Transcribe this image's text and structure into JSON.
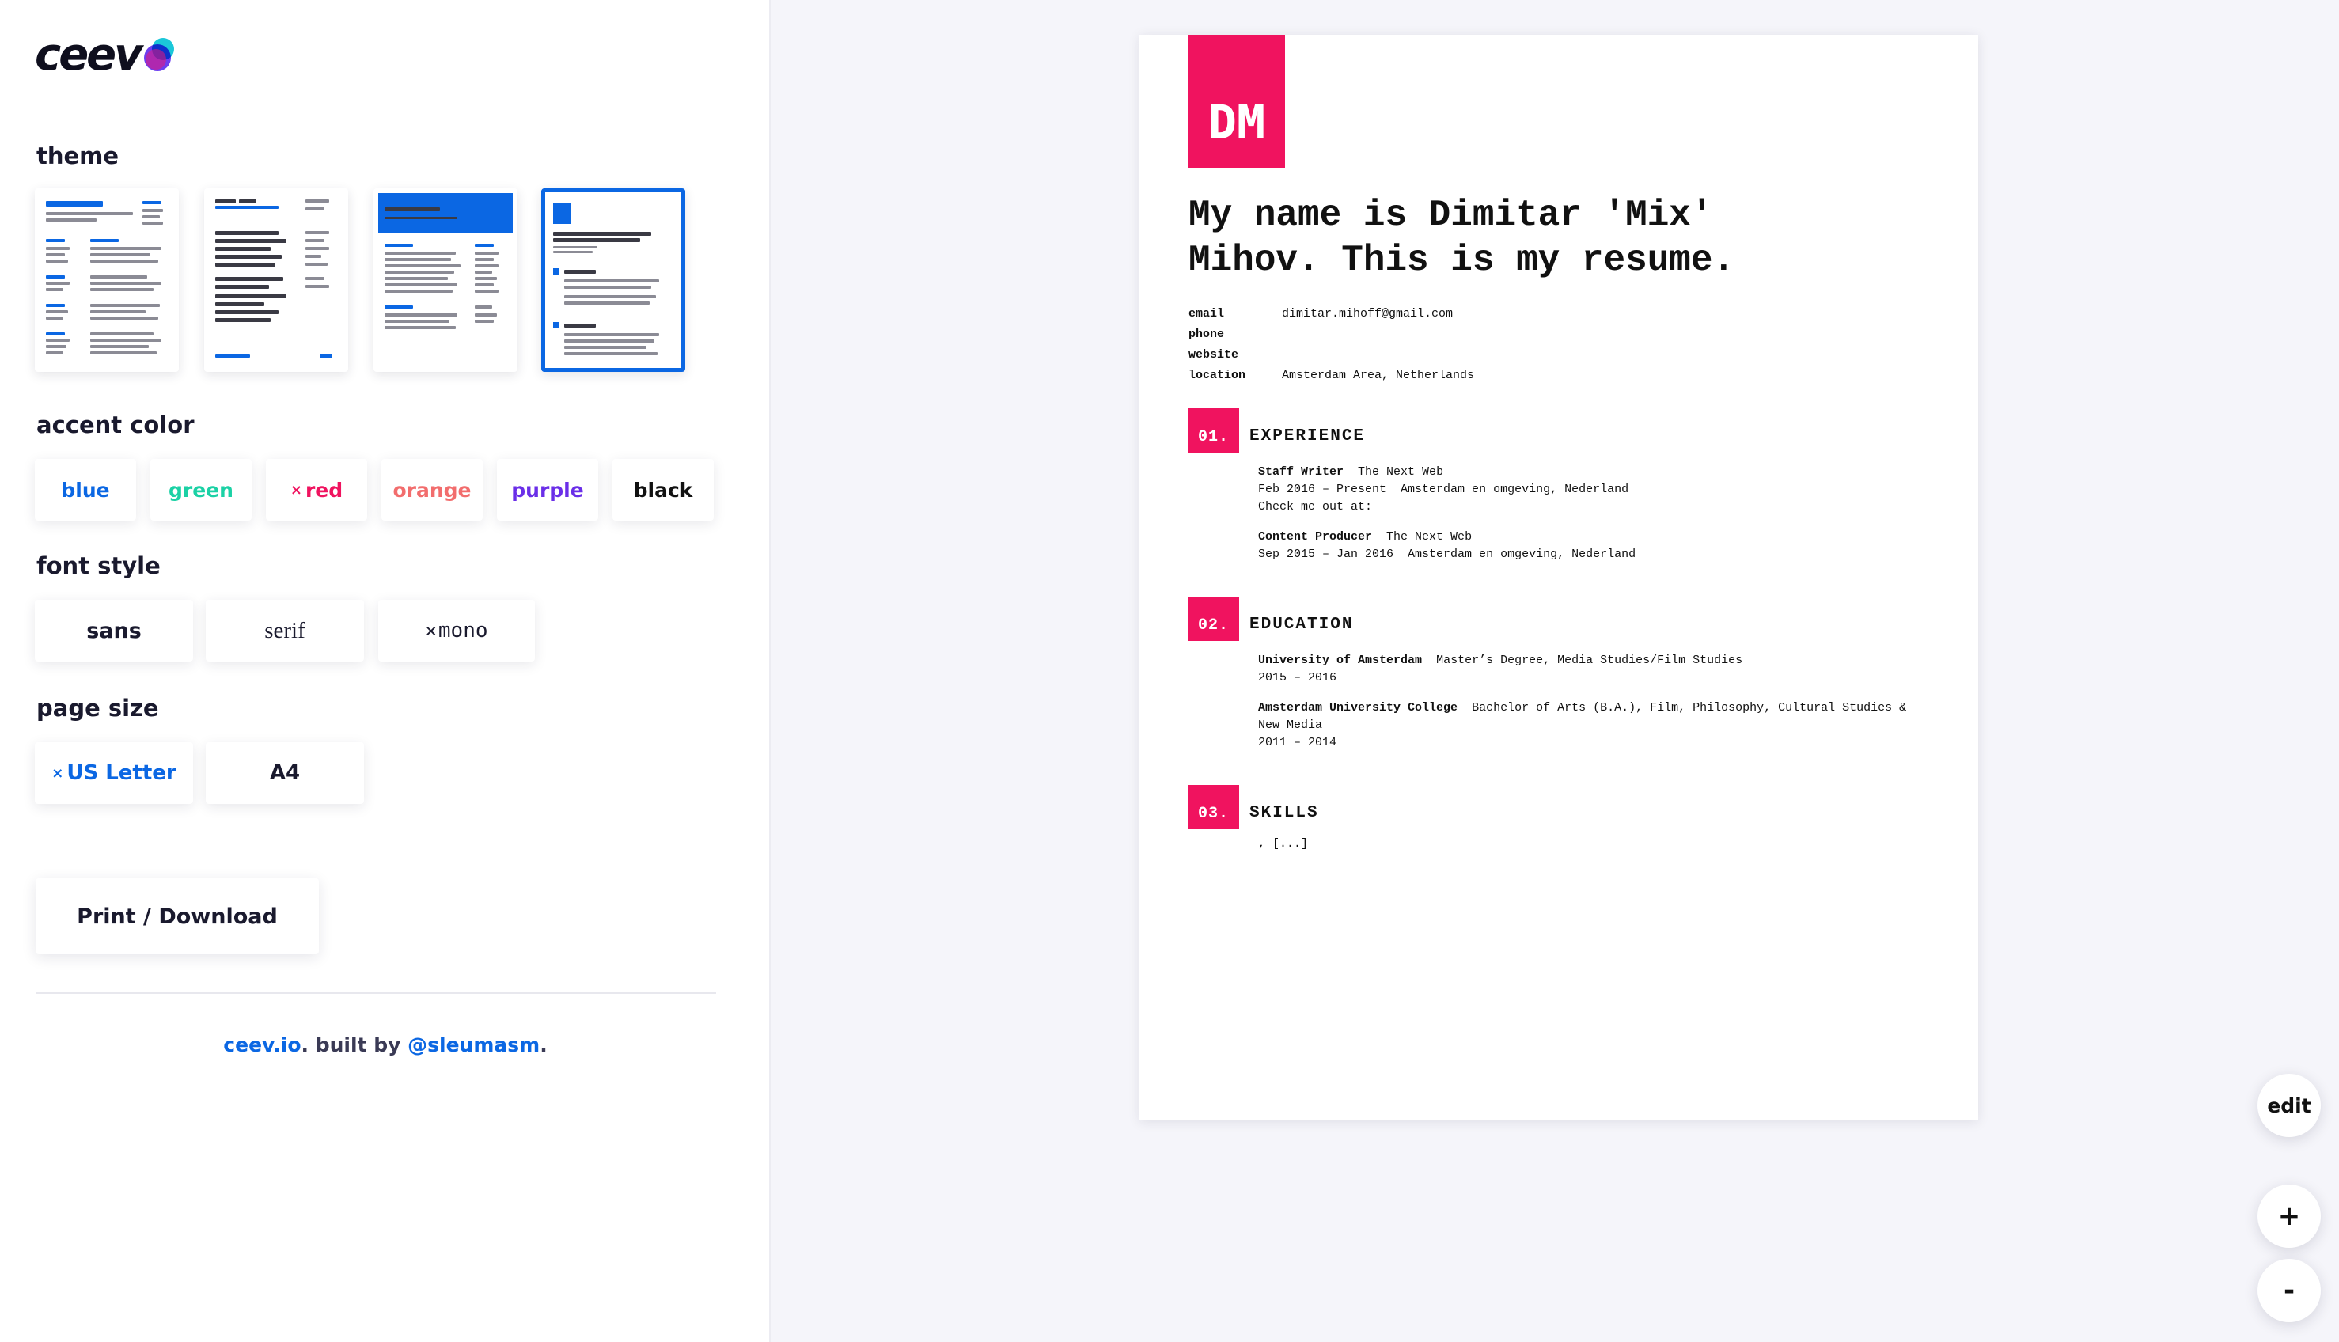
{
  "app": {
    "logo": "ceev"
  },
  "sidebar": {
    "theme_label": "theme",
    "accent_label": "accent color",
    "accent_options": [
      {
        "label": "blue",
        "color": "#0b67e3",
        "selected": false
      },
      {
        "label": "green",
        "color": "#1bd1a5",
        "selected": false
      },
      {
        "label": "red",
        "color": "#f0135f",
        "selected": true
      },
      {
        "label": "orange",
        "color": "#f26d6d",
        "selected": false
      },
      {
        "label": "purple",
        "color": "#6a2ee8",
        "selected": false
      },
      {
        "label": "black",
        "color": "#111111",
        "selected": false
      }
    ],
    "font_label": "font style",
    "font_options": [
      {
        "label": "sans",
        "selected": false
      },
      {
        "label": "serif",
        "selected": false
      },
      {
        "label": "mono",
        "selected": true
      }
    ],
    "size_label": "page size",
    "size_options": [
      {
        "label": "US Letter",
        "selected": true
      },
      {
        "label": "A4",
        "selected": false
      }
    ],
    "selected_mark": "×",
    "print_label": "Print / Download",
    "footer": {
      "site": "ceev.io",
      "built_by": ". built by ",
      "author": "@sleumasm",
      "end": "."
    }
  },
  "resume": {
    "initials": "DM",
    "title": "My name is Dimitar 'Mix' Mihov. This is my resume.",
    "contact": {
      "email_label": "email",
      "email": "dimitar.mihoff@gmail.com",
      "phone_label": "phone",
      "phone": "",
      "website_label": "website",
      "website": "",
      "location_label": "location",
      "location": "Amsterdam Area, Netherlands"
    },
    "experience": {
      "num": "01.",
      "title": "EXPERIENCE",
      "jobs": [
        {
          "role": "Staff Writer",
          "company": "The Next Web",
          "dates": "Feb 2016 – Present",
          "place": "Amsterdam en omgeving, Nederland",
          "note": "Check me out at:"
        },
        {
          "role": "Content Producer",
          "company": "The Next Web",
          "dates": "Sep 2015 – Jan 2016",
          "place": "Amsterdam en omgeving, Nederland"
        }
      ]
    },
    "education": {
      "num": "02.",
      "title": "EDUCATION",
      "schools": [
        {
          "name": "University of Amsterdam",
          "degree": "Master’s Degree, Media Studies/Film Studies",
          "dates": "2015 – 2016"
        },
        {
          "name": "Amsterdam University College",
          "degree": "Bachelor of Arts (B.A.), Film, Philosophy, Cultural Studies & New Media",
          "dates": "2011 – 2014"
        }
      ]
    },
    "skills": {
      "num": "03.",
      "title": "SKILLS",
      "text": ", [...]"
    }
  },
  "controls": {
    "edit": "edit",
    "zoom_in": "+",
    "zoom_out": "-"
  }
}
